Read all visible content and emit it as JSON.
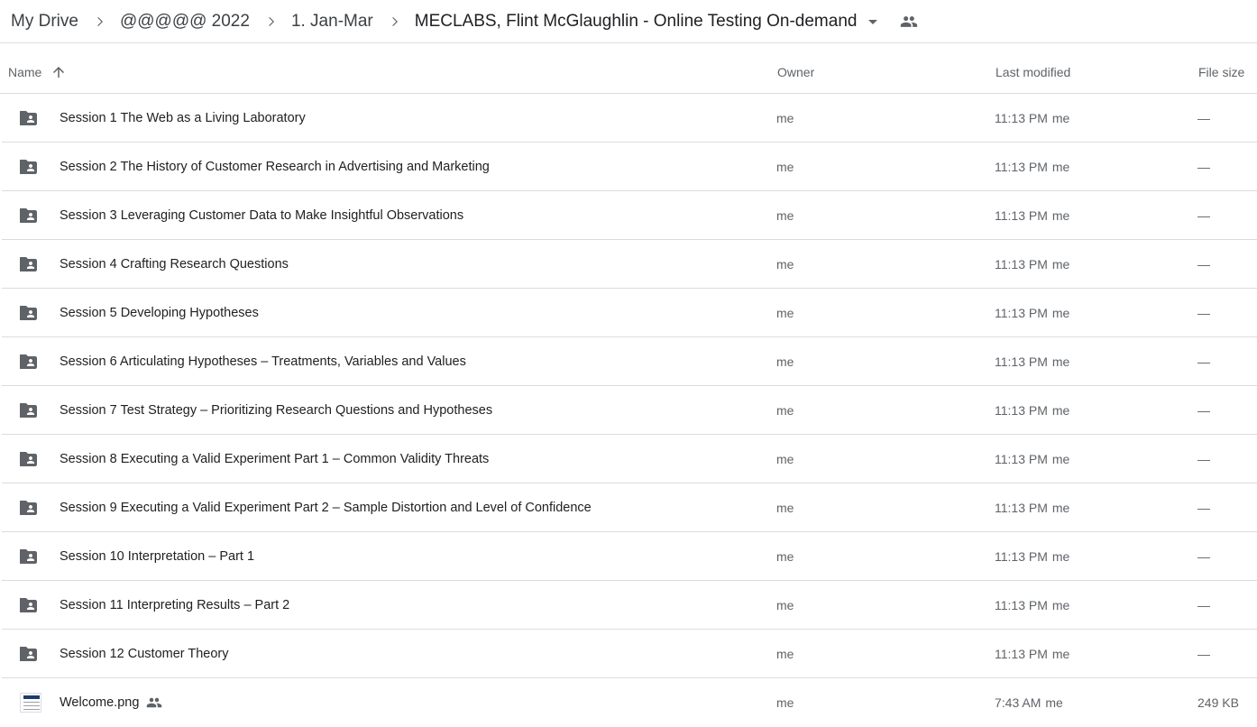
{
  "breadcrumb": {
    "items": [
      "My Drive",
      "@@@@@ 2022",
      "1. Jan-Mar"
    ],
    "current": "MECLABS, Flint McGlaughlin - Online Testing On-demand"
  },
  "columns": {
    "name": "Name",
    "owner": "Owner",
    "last_modified": "Last modified",
    "file_size": "File size"
  },
  "rows": [
    {
      "name": "Session 1 The Web as a Living Laboratory",
      "type": "shared-folder",
      "owner": "me",
      "modified_time": "11:13 PM",
      "modified_by": "me",
      "size": "—"
    },
    {
      "name": "Session 2 The History of Customer Research in Advertising and Marketing",
      "type": "shared-folder",
      "owner": "me",
      "modified_time": "11:13 PM",
      "modified_by": "me",
      "size": "—"
    },
    {
      "name": "Session 3 Leveraging Customer Data to Make Insightful Observations",
      "type": "shared-folder",
      "owner": "me",
      "modified_time": "11:13 PM",
      "modified_by": "me",
      "size": "—"
    },
    {
      "name": "Session 4 Crafting Research Questions",
      "type": "shared-folder",
      "owner": "me",
      "modified_time": "11:13 PM",
      "modified_by": "me",
      "size": "—"
    },
    {
      "name": "Session 5 Developing Hypotheses",
      "type": "shared-folder",
      "owner": "me",
      "modified_time": "11:13 PM",
      "modified_by": "me",
      "size": "—"
    },
    {
      "name": "Session 6 Articulating Hypotheses – Treatments, Variables and Values",
      "type": "shared-folder",
      "owner": "me",
      "modified_time": "11:13 PM",
      "modified_by": "me",
      "size": "—"
    },
    {
      "name": "Session 7 Test Strategy – Prioritizing Research Questions and Hypotheses",
      "type": "shared-folder",
      "owner": "me",
      "modified_time": "11:13 PM",
      "modified_by": "me",
      "size": "—"
    },
    {
      "name": "Session 8 Executing a Valid Experiment Part 1 – Common Validity Threats",
      "type": "shared-folder",
      "owner": "me",
      "modified_time": "11:13 PM",
      "modified_by": "me",
      "size": "—"
    },
    {
      "name": "Session 9 Executing a Valid Experiment Part 2 – Sample Distortion and Level of Confidence",
      "type": "shared-folder",
      "owner": "me",
      "modified_time": "11:13 PM",
      "modified_by": "me",
      "size": "—"
    },
    {
      "name": "Session 10 Interpretation – Part 1",
      "type": "shared-folder",
      "owner": "me",
      "modified_time": "11:13 PM",
      "modified_by": "me",
      "size": "—"
    },
    {
      "name": "Session 11 Interpreting Results – Part 2",
      "type": "shared-folder",
      "owner": "me",
      "modified_time": "11:13 PM",
      "modified_by": "me",
      "size": "—"
    },
    {
      "name": "Session 12 Customer Theory",
      "type": "shared-folder",
      "owner": "me",
      "modified_time": "11:13 PM",
      "modified_by": "me",
      "size": "—"
    },
    {
      "name": "Welcome.png",
      "type": "image-file",
      "shared": true,
      "owner": "me",
      "modified_time": "7:43 AM",
      "modified_by": "me",
      "size": "249 KB"
    }
  ],
  "icons": {
    "breadcrumb_separator": "chevron-right-icon",
    "dropdown": "arrow-drop-down-icon",
    "shared": "people-icon",
    "sort": "arrow-up-icon",
    "folder": "shared-folder-icon",
    "image": "image-thumbnail-icon"
  },
  "colors": {
    "icon_gray": "#5f6368",
    "divider": "#dadce0"
  }
}
